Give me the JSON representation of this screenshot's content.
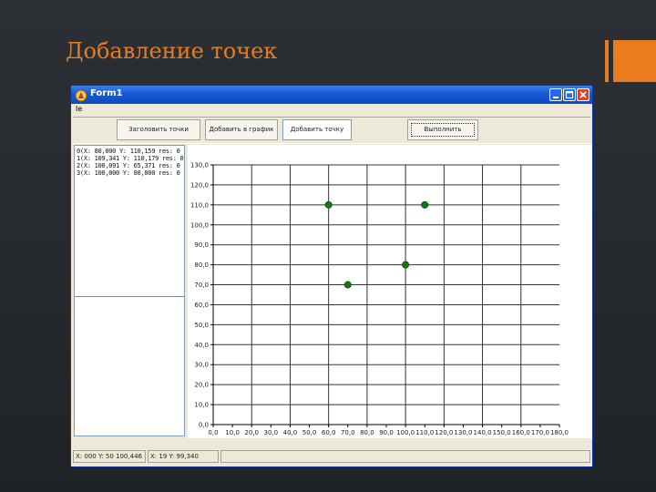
{
  "slide": {
    "title": "Добавление точек",
    "accent_color": "#e87c1f"
  },
  "window": {
    "title": "Form1",
    "icon": "delphi-app-icon",
    "controls": [
      "minimize-icon",
      "maximize-icon",
      "close-icon"
    ]
  },
  "menu": {
    "file_label": "Ie"
  },
  "toolbar": {
    "buttons": [
      "Заголовить точки",
      "Добавить в график",
      "Добавить точку",
      "Выполнить"
    ]
  },
  "points_list": {
    "items": [
      "0(X: 80,000 Y: 110,159 res: 0",
      "1(X: 109,341 Y: 110,179 res: 0",
      "2(X: 100,091 Y: 65,371 res: 0",
      "3(X: 100,000 Y: 80,000 res: 0"
    ]
  },
  "chart_data": {
    "type": "scatter",
    "title": "",
    "xlabel": "",
    "ylabel": "",
    "x_ticks": [
      "0,0",
      "10,0",
      "20,0",
      "30,0",
      "40,0",
      "50,0",
      "60,0",
      "70,0",
      "80,0",
      "90,0",
      "100,0",
      "110,0",
      "120,0",
      "130,0",
      "140,0",
      "150,0",
      "160,0",
      "170,0",
      "180,0"
    ],
    "y_ticks": [
      "0,0",
      "10,0",
      "20,0",
      "30,0",
      "40,0",
      "50,0",
      "60,0",
      "70,0",
      "80,0",
      "90,0",
      "100,0",
      "110,0",
      "120,0",
      "130,0"
    ],
    "xlim": [
      0,
      180
    ],
    "ylim": [
      0,
      130
    ],
    "grid": true,
    "marker_color": "#137a13",
    "points": [
      {
        "x": 60,
        "y": 110
      },
      {
        "x": 70,
        "y": 70
      },
      {
        "x": 100,
        "y": 80
      },
      {
        "x": 110,
        "y": 110
      }
    ]
  },
  "status": {
    "cells": [
      "X: 000 Y: 50 100,446",
      "X: 19 Y: 99,340"
    ]
  }
}
